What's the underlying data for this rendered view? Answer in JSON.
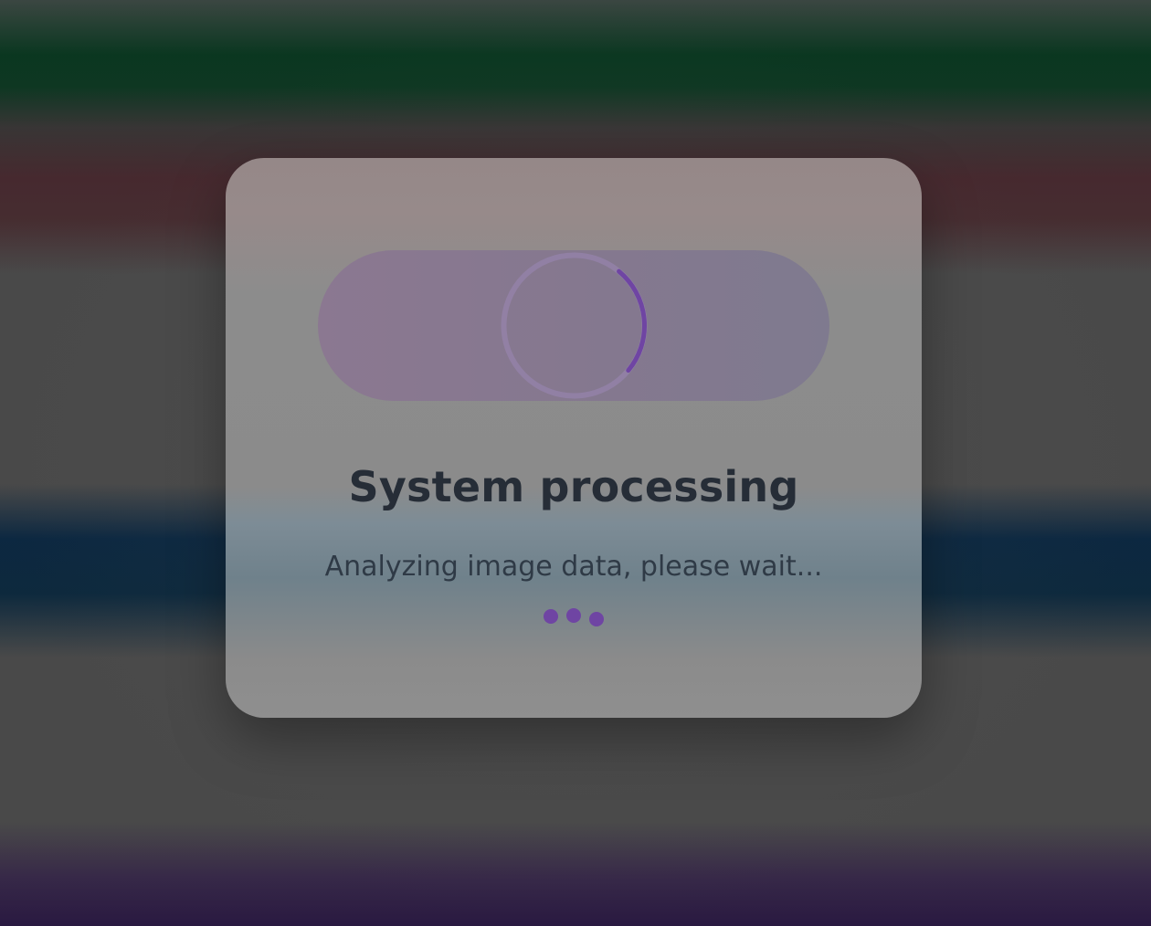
{
  "dialog": {
    "title": "System processing",
    "message": "Analyzing image data, please wait..."
  },
  "progress": {
    "spinner_arc_fraction": 0.25
  },
  "icons": {
    "spinner": "loading-spinner-icon",
    "dots": "typing-dots-icon"
  },
  "colors": {
    "accent": "#6f45a3",
    "title_text": "#262d37",
    "message_text": "#2f3a46"
  }
}
